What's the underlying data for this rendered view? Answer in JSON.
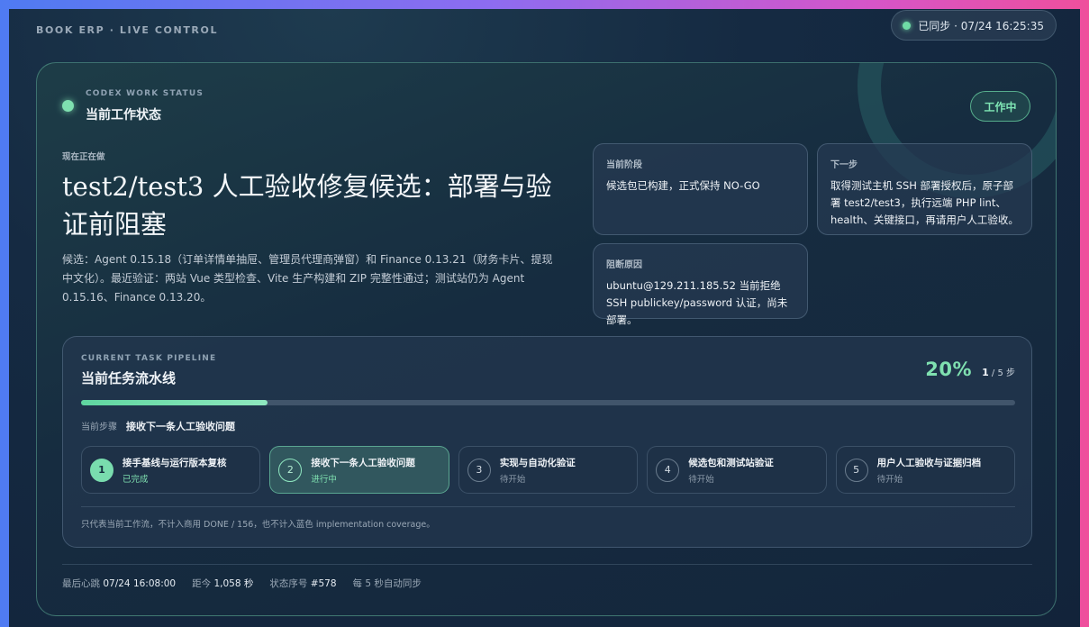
{
  "header": {
    "brand": "BOOK ERP · LIVE CONTROL",
    "sync_text": "已同步 · 07/24 16:25:35"
  },
  "status_card": {
    "eyebrow": "CODEX WORK STATUS",
    "title": "当前工作状态",
    "badge": "工作中",
    "now_label": "现在正在做",
    "headline": "test2/test3 人工验收修复候选：部署与验证前阻塞",
    "description": "候选：Agent 0.15.18（订单详情单抽屉、管理员代理商弹窗）和 Finance 0.13.21（财务卡片、提现中文化）。最近验证：两站 Vue 类型检查、Vite 生产构建和 ZIP 完整性通过；测试站仍为 Agent 0.15.16、Finance 0.13.20。",
    "current_phase": {
      "label": "当前阶段",
      "text": "候选包已构建，正式保持 NO-GO"
    },
    "next_step": {
      "label": "下一步",
      "text": "取得测试主机 SSH 部署授权后，原子部署 test2/test3，执行远端 PHP lint、health、关键接口，再请用户人工验收。"
    },
    "blocker": {
      "label": "阻断原因",
      "text": "ubuntu@129.211.185.52 当前拒绝 SSH publickey/password 认证，尚未部署。"
    }
  },
  "pipeline": {
    "eyebrow": "CURRENT TASK PIPELINE",
    "title": "当前任务流水线",
    "percent_text": "20%",
    "progress_fraction": 0.2,
    "step_current": "1",
    "step_total_text": "/ 5 步",
    "current_step_label": "当前步骤",
    "current_step_value": "接收下一条人工验收问题",
    "steps": [
      {
        "num": "1",
        "title": "接手基线与运行版本复核",
        "status": "已完成"
      },
      {
        "num": "2",
        "title": "接收下一条人工验收问题",
        "status": "进行中"
      },
      {
        "num": "3",
        "title": "实现与自动化验证",
        "status": "待开始"
      },
      {
        "num": "4",
        "title": "候选包和测试站验证",
        "status": "待开始"
      },
      {
        "num": "5",
        "title": "用户人工验收与证据归档",
        "status": "待开始"
      }
    ],
    "note": "只代表当前工作流，不计入商用 DONE / 156，也不计入蓝色 implementation coverage。"
  },
  "footer": {
    "heartbeat_label": "最后心跳",
    "heartbeat_value": "07/24 16:08:00",
    "since_label": "距今",
    "since_value": "1,058 秒",
    "seq_label": "状态序号",
    "seq_value": "#578",
    "auto_sync": "每 5 秒自动同步"
  },
  "colors": {
    "accent": "#7fe0b0",
    "background": "#152a42"
  }
}
